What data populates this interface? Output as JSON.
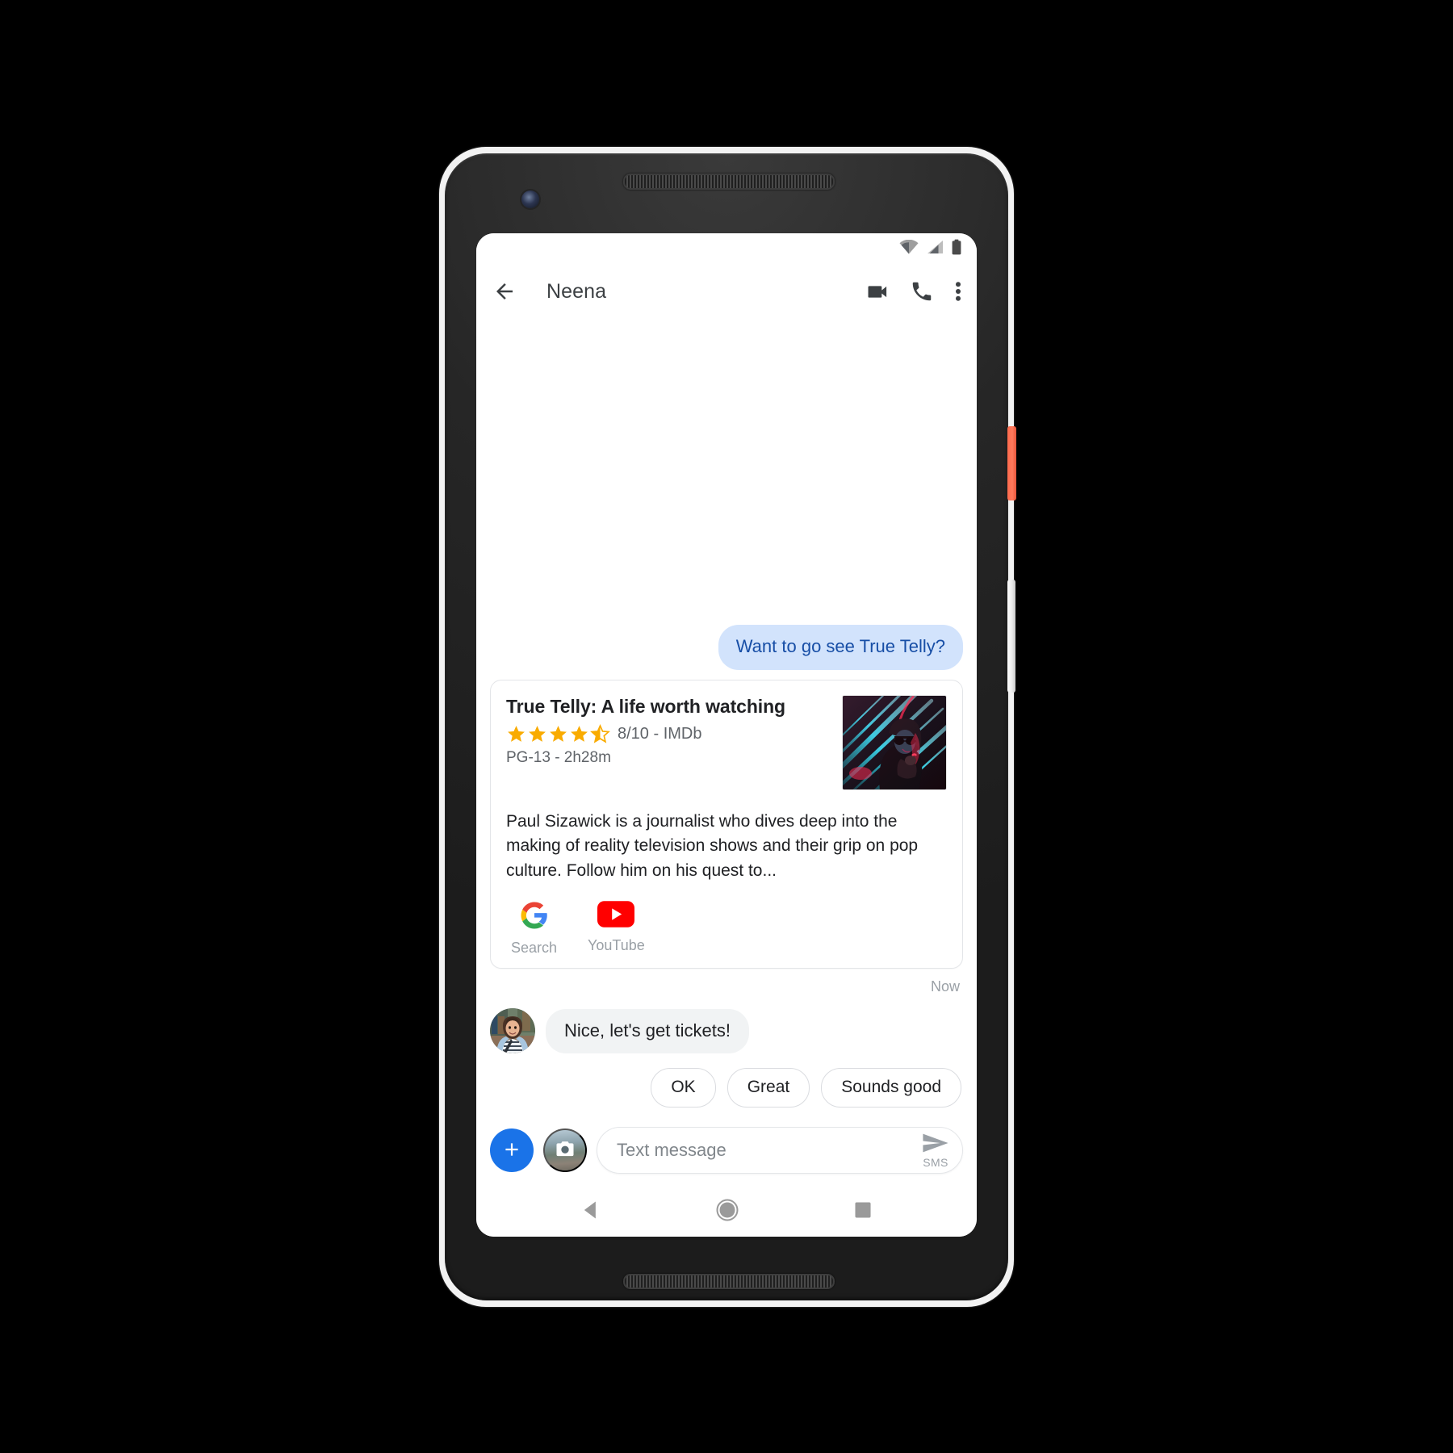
{
  "device": {
    "name": "pixel-phone",
    "accent_power_button_color": "#ff6a4d",
    "body_color": "#262626",
    "frame_color": "#f2f2f2"
  },
  "statusbar": {
    "icons": [
      "wifi-icon",
      "cellular-signal-icon",
      "battery-icon"
    ]
  },
  "appbar": {
    "back_icon": "back-arrow-icon",
    "title": "Neena",
    "actions": [
      {
        "name": "video-call-button",
        "icon": "video-camera-icon"
      },
      {
        "name": "voice-call-button",
        "icon": "phone-icon"
      },
      {
        "name": "overflow-menu-button",
        "icon": "more-vert-icon"
      }
    ]
  },
  "conversation": {
    "outgoing_message": {
      "text": "Want to go see True Telly?",
      "bubble_color": "#d2e3fc",
      "text_color": "#174ea6"
    },
    "rich_card": {
      "title": "True Telly: A life worth watching",
      "rating_stars": 4.5,
      "rating_max": 5,
      "score": "8/10 - IMDb",
      "meta": "PG-13 - 2h28m",
      "description": "Paul Sizawick is a journalist who dives deep into the making of reality television shows and their grip on pop culture. Follow him on his quest to...",
      "thumbnail_alt": "neon-portrait-thumbnail",
      "actions": [
        {
          "name": "google-search-action",
          "label": "Search",
          "icon": "google-g-icon"
        },
        {
          "name": "youtube-action",
          "label": "YouTube",
          "icon": "youtube-icon"
        }
      ]
    },
    "timestamp": "Now",
    "incoming_message": {
      "text": "Nice, let's get tickets!",
      "avatar_alt": "neena-avatar",
      "bubble_color": "#f1f3f4"
    },
    "smart_replies": [
      "OK",
      "Great",
      "Sounds good"
    ]
  },
  "composer": {
    "add_button_icon": "plus-icon",
    "add_button_color": "#1a73e8",
    "camera_button_icon": "camera-icon",
    "input_placeholder": "Text message",
    "input_value": "",
    "send_icon": "send-arrow-icon",
    "send_label": "SMS"
  },
  "navbar": {
    "buttons": [
      {
        "name": "nav-back-button",
        "icon": "triangle-back-icon"
      },
      {
        "name": "nav-home-button",
        "icon": "circle-home-icon"
      },
      {
        "name": "nav-recents-button",
        "icon": "square-recents-icon"
      }
    ]
  }
}
